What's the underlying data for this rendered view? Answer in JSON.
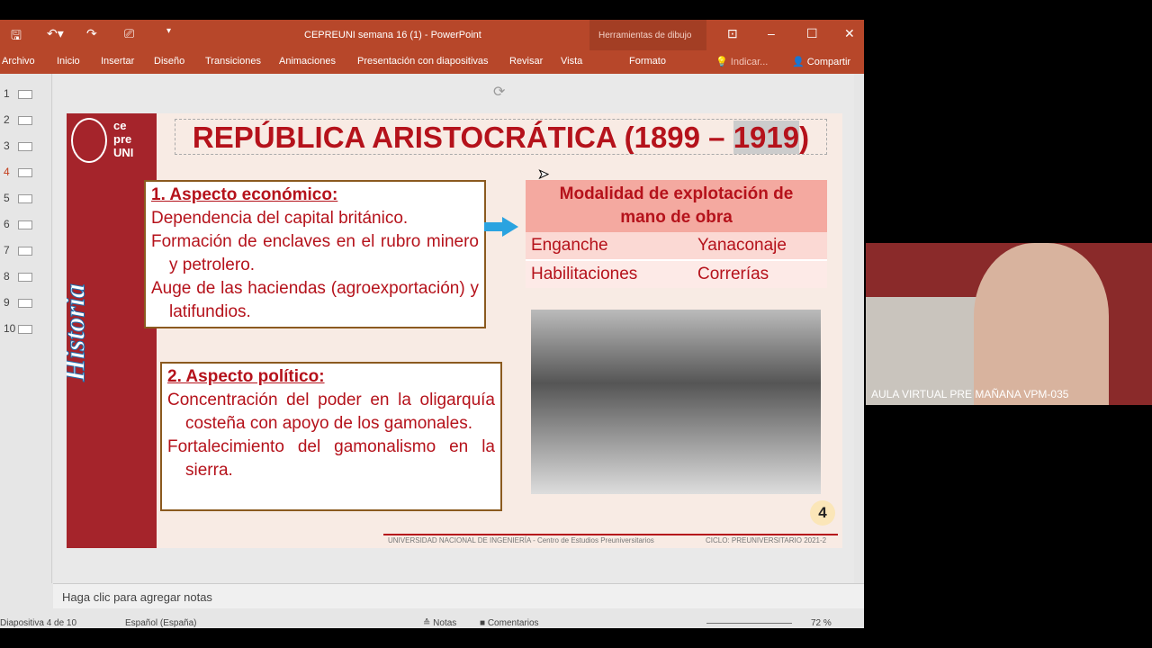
{
  "window": {
    "title": "CEPREUNI semana 16 (1) - PowerPoint",
    "tools_label": "Herramientas de dibujo"
  },
  "ribbon": {
    "tabs": [
      "Archivo",
      "Inicio",
      "Insertar",
      "Diseño",
      "Transiciones",
      "Animaciones",
      "Presentación con diapositivas",
      "Revisar",
      "Vista"
    ],
    "format": "Formato",
    "tell_me": "Indicar...",
    "share": "Compartir"
  },
  "thumbs": [
    "1",
    "2",
    "3",
    "4",
    "5",
    "6",
    "7",
    "8",
    "9",
    "10"
  ],
  "slide": {
    "logo": "ce pre UNI",
    "side_title": "Historia",
    "title": "REPÚBLICA ARISTOCRÁTICA (1899 – ",
    "title_year": "1919",
    "title_end": ")",
    "econ": {
      "heading": "1. Aspecto económico:",
      "items": [
        "Dependencia del capital británico.",
        "Formación de enclaves en el rubro minero y petrolero.",
        "Auge de las haciendas (agroexportación) y latifundios."
      ]
    },
    "pol": {
      "heading": "2. Aspecto político:",
      "items": [
        "Concentración del poder en la oligarquía costeña con apoyo de los gamonales.",
        "Fortalecimiento del gamonalismo en la sierra."
      ]
    },
    "table": {
      "header": "Modalidad de explotación de mano de obra",
      "rows": [
        [
          "Enganche",
          "Yanaconaje"
        ],
        [
          "Habilitaciones",
          "Correrías"
        ]
      ]
    },
    "page_number": "4",
    "footer_left": "UNIVERSIDAD NACIONAL DE INGENIERÍA - Centro de Estudios Preuniversitarios",
    "footer_right": "CICLO: PREUNIVERSITARIO 2021-2"
  },
  "notes_placeholder": "Haga clic para agregar notas",
  "status": {
    "slide": "Diapositiva 4 de 10",
    "language": "Español (España)",
    "notes": "Notas",
    "comments": "Comentarios",
    "zoom": "72 %"
  },
  "webcam": {
    "label": "AULA VIRTUAL PRE MAÑANA VPM-035"
  },
  "colors": {
    "ribbon": "#b7472a",
    "slide_red": "#b5121b"
  }
}
